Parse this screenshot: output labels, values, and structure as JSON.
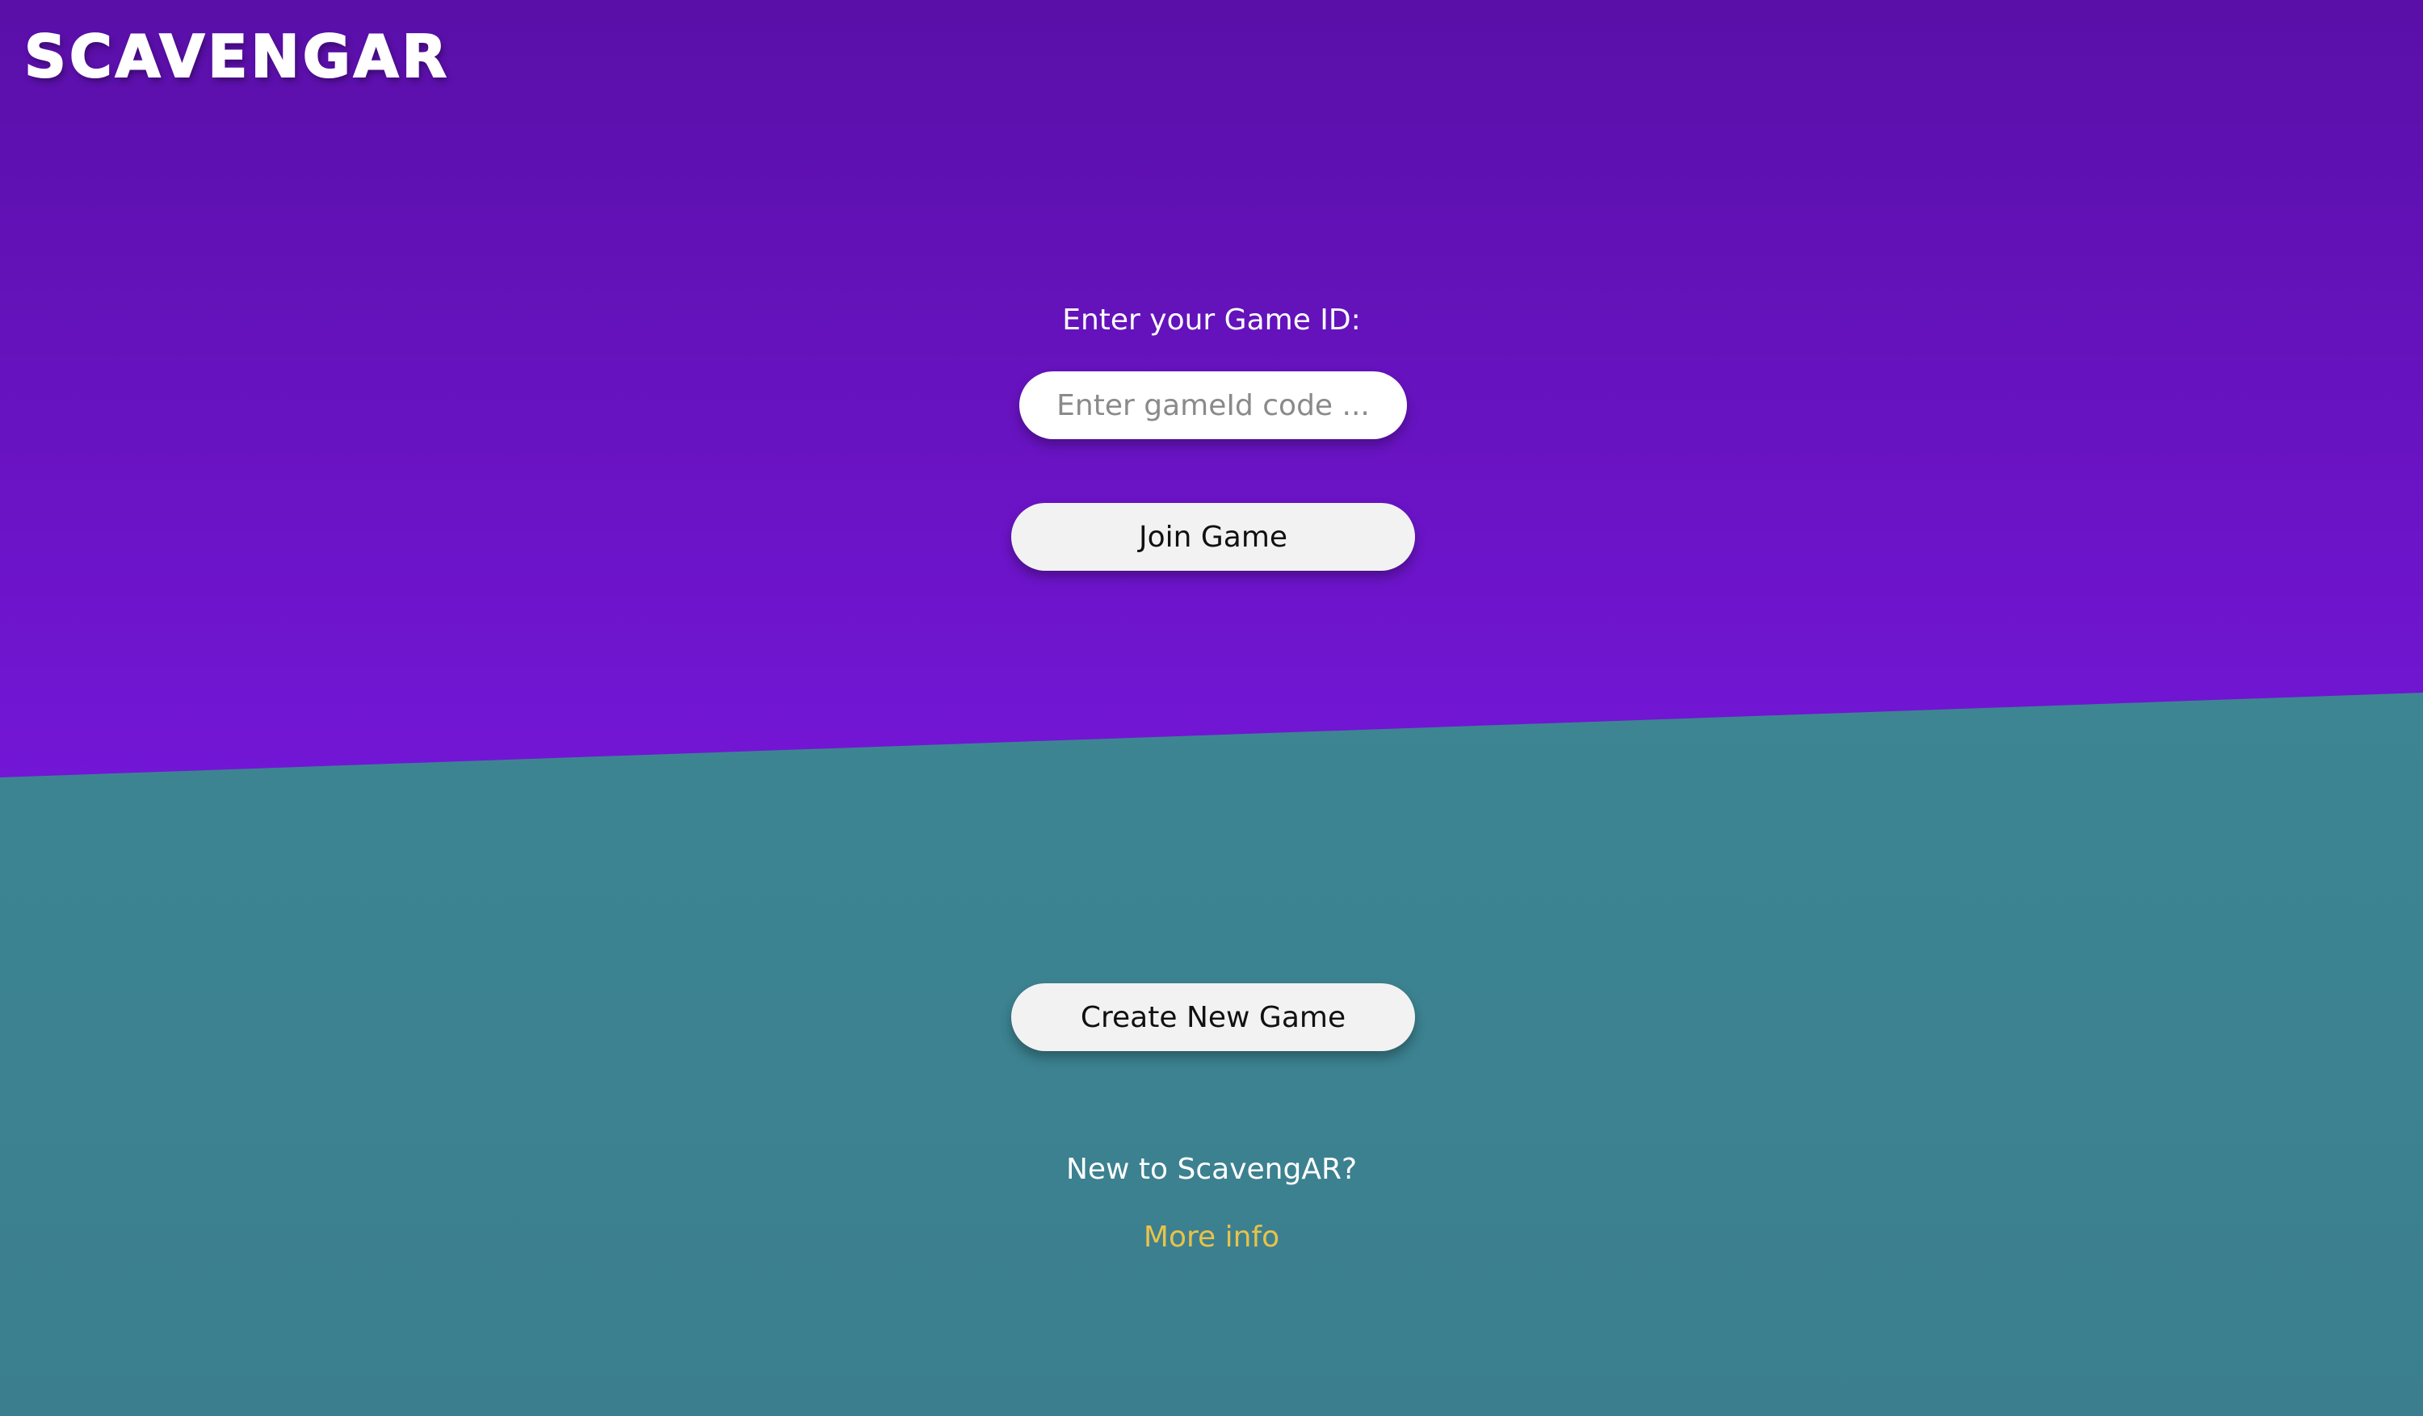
{
  "app": {
    "logo_text": "SCAVENGAR"
  },
  "join": {
    "label": "Enter your Game ID:",
    "input_placeholder": "Enter gameId code ...",
    "input_value": "",
    "button_label": "Join Game"
  },
  "create": {
    "button_label": "Create New Game"
  },
  "info": {
    "prompt": "New to ScavengAR?",
    "link_label": "More info"
  },
  "colors": {
    "top_band": "#6a14c4",
    "bottom_band": "#3e8896",
    "link": "#e8c24a",
    "button_bg": "#f2f2f2"
  }
}
